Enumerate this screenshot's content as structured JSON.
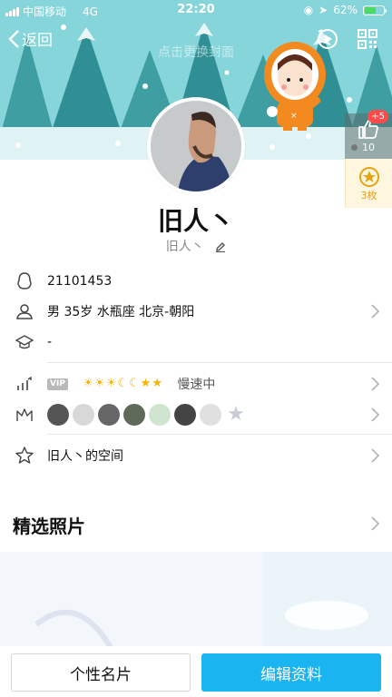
{
  "status_bar": {
    "carrier": "中国移动",
    "network": "4G",
    "time": "22:20",
    "battery": "62%",
    "battery_level": 0.62
  },
  "nav": {
    "back_label": "返回",
    "cover_hint": "点击更换封面"
  },
  "likes": {
    "plus": "+5",
    "count": "10"
  },
  "medals": {
    "label": "3枚"
  },
  "profile": {
    "nickname": "旧人丶",
    "remark": "旧人丶"
  },
  "info": {
    "qq": "21101453",
    "personal": "男  35岁  水瓶座  北京-朝阳",
    "education": "-",
    "vip_tag": "VIP",
    "level_icons": [
      "☀",
      "☀",
      "☀",
      "☾",
      "☾",
      "★",
      "★"
    ],
    "speed": "慢速中",
    "space": "旧人丶的空间"
  },
  "section": {
    "photos_title": "精选照片"
  },
  "buttons": {
    "card": "个性名片",
    "edit": "编辑资料"
  },
  "colors": {
    "accent": "#1ab4f0",
    "medal": "#e4a311",
    "cover": "#7fd0d6"
  }
}
